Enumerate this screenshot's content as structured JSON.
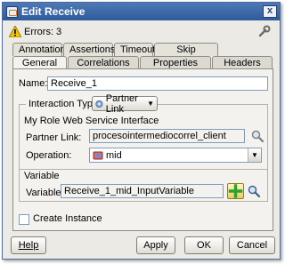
{
  "window": {
    "title": "Edit Receive",
    "close_glyph": "x"
  },
  "status": {
    "errors_text": "Errors: 3"
  },
  "tabs_back": [
    "Annotations",
    "Assertions",
    "Timeout",
    "Skip Condition"
  ],
  "tabs_front": [
    "General",
    "Correlations",
    "Properties",
    "Headers"
  ],
  "active_tab": "General",
  "general": {
    "name_label": "Name:",
    "name_value": "Receive_1",
    "interaction_label": "Interaction Type:",
    "interaction_value": "Partner Link",
    "role_group_label": "My Role Web Service Interface",
    "partner_link_label": "Partner Link:",
    "partner_link_value": "procesointermediocorrel_client",
    "operation_label": "Operation:",
    "operation_value": "mid",
    "variable_group_label": "Variable",
    "variable_label": "Variable:",
    "variable_value": "Receive_1_mid_InputVariable",
    "create_instance_label": "Create Instance",
    "create_instance_checked": false
  },
  "buttons": {
    "help": "Help",
    "apply": "Apply",
    "ok": "OK",
    "cancel": "Cancel"
  },
  "icons": {
    "title": "receive-icon",
    "errors": "warning-icon",
    "wrench": "wrench-icon",
    "interaction": "partner-link-icon",
    "operation": "operation-icon",
    "search": "magnifier-icon",
    "add": "plus-icon"
  },
  "colors": {
    "titlebar": "#3b67a6",
    "warning": "#f2c200",
    "add_plus": "#2ea02e"
  }
}
